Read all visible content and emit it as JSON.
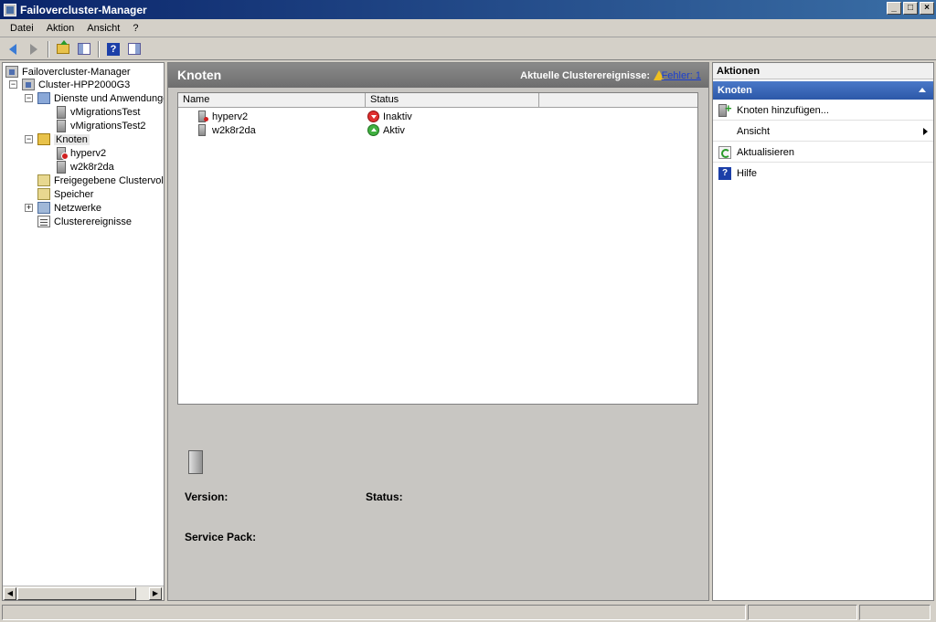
{
  "window": {
    "title": "Failovercluster-Manager"
  },
  "menu": [
    "Datei",
    "Aktion",
    "Ansicht",
    "?"
  ],
  "tree": {
    "root": "Failovercluster-Manager",
    "cluster": "Cluster-HPP2000G3",
    "services": "Dienste und Anwendungen",
    "services_children": [
      "vMigrationsTest",
      "vMigrationsTest2"
    ],
    "nodes": "Knoten",
    "nodes_children": [
      "hyperv2",
      "w2k8r2da"
    ],
    "shared_volumes": "Freigegebene Clustervolur",
    "storage": "Speicher",
    "networks": "Netzwerke",
    "events": "Clusterereignisse"
  },
  "center": {
    "title": "Knoten",
    "events_label": "Aktuelle Clusterereignisse:",
    "error_link": "Fehler: 1",
    "columns": [
      "Name",
      "Status"
    ],
    "rows": [
      {
        "name": "hyperv2",
        "status": "Inaktiv",
        "state": "down"
      },
      {
        "name": "w2k8r2da",
        "status": "Aktiv",
        "state": "up"
      }
    ],
    "details": {
      "version_label": "Version:",
      "status_label": "Status:",
      "service_pack_label": "Service Pack:"
    }
  },
  "actions": {
    "title": "Aktionen",
    "section": "Knoten",
    "items": [
      "Knoten hinzufügen...",
      "Ansicht",
      "Aktualisieren",
      "Hilfe"
    ]
  },
  "colors": {
    "titlebar": "#0a246a",
    "section_header": "#2c58a8",
    "status_down": "#e03030",
    "status_up": "#40b040",
    "link": "#1a3fd0"
  }
}
